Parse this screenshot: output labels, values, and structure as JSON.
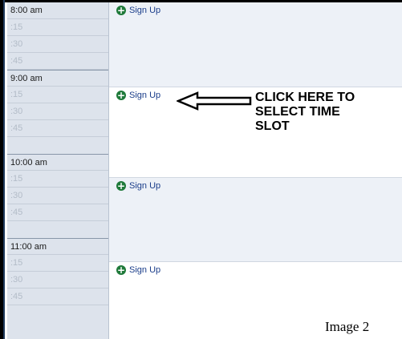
{
  "schedule": {
    "hours": [
      {
        "label": "8:00 am",
        "quarters": [
          ":15",
          ":30",
          ":45"
        ]
      },
      {
        "label": "9:00 am",
        "quarters": [
          ":15",
          ":30",
          ":45"
        ]
      },
      {
        "label": "10:00 am",
        "quarters": [
          ":15",
          ":30",
          ":45"
        ]
      },
      {
        "label": "11:00 am",
        "quarters": [
          ":15",
          ":30",
          ":45"
        ]
      }
    ],
    "signup_label": "Sign Up",
    "signup_icon": "plus-circle-icon"
  },
  "annotation": {
    "line1": "CLICK HERE TO",
    "line2": "SELECT TIME",
    "line3": "SLOT"
  },
  "caption": "Image 2",
  "colors": {
    "signup_icon": "#1f7a3a",
    "signup_text": "#1a3d8a",
    "shaded_slot": "#edf1f7",
    "time_column": "#dde3ec"
  }
}
